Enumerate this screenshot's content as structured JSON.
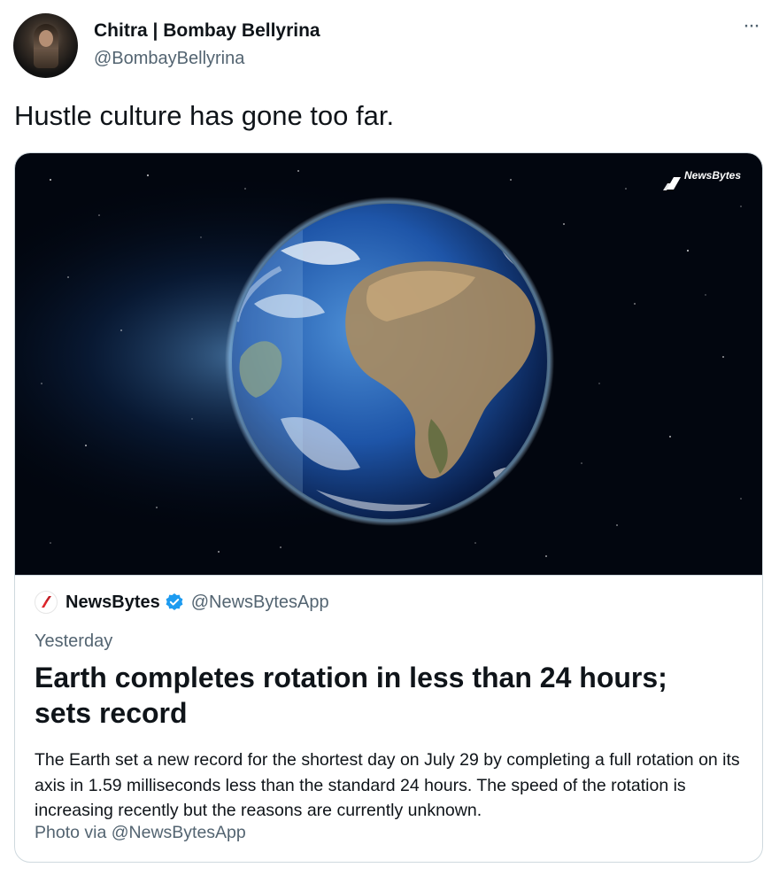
{
  "author": {
    "name": "Chitra | Bombay Bellyrina",
    "handle": "@BombayBellyrina"
  },
  "menu": {
    "more_label": "···"
  },
  "tweet": {
    "text": "Hustle culture has gone too far."
  },
  "card": {
    "image_watermark": "NewsBytes",
    "source_name": "NewsBytes",
    "source_handle": "@NewsBytesApp",
    "date": "Yesterday",
    "headline": "Earth completes rotation in less than 24 hours; sets record",
    "body": "The Earth set a new record for the shortest day on July 29 by completing a full rotation on its axis in 1.59 milliseconds less than the standard 24 hours. The speed of the rotation is increasing recently but the reasons are currently unknown.",
    "credit": "Photo via @NewsBytesApp"
  },
  "colors": {
    "text": "#0f1419",
    "secondary": "#536471",
    "border": "#cfd9de",
    "verified": "#1d9bf0",
    "brand": "#e0262b"
  },
  "icons": [
    "more-icon",
    "newsbytes-logo-icon",
    "verified-badge-icon"
  ]
}
